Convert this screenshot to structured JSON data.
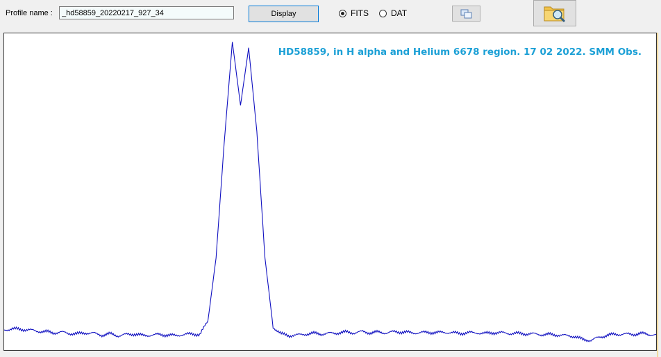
{
  "toolbar": {
    "profile_label": "Profile name :",
    "profile_value": "_hd58859_20220217_927_34",
    "display_label": "Display",
    "radio_fits_label": "FITS",
    "radio_dat_label": "DAT",
    "selected_format": "FITS"
  },
  "icons": {
    "copy": "copy-icon",
    "open": "folder-search-icon"
  },
  "plot": {
    "title": "HD58859, in H alpha and Helium 6678 region.  17 02 2022. SMM Obs.",
    "title_color": "#1ca0d6",
    "line_color": "#1010c0"
  },
  "chart_data": {
    "type": "line",
    "title": "HD58859, in H alpha and Helium 6678 region.  17 02 2022. SMM Obs.",
    "xlabel": "",
    "ylabel": "",
    "grid": false,
    "x": [
      0,
      5,
      10,
      15,
      20,
      25,
      30,
      35,
      40,
      45,
      50,
      55,
      60,
      65,
      70,
      75,
      80,
      85,
      90,
      95,
      100,
      105,
      110,
      115,
      120,
      125,
      130,
      135,
      140,
      145,
      150,
      155,
      160,
      165,
      170,
      175,
      180,
      185,
      190,
      195,
      200,
      205,
      210,
      215,
      220,
      225,
      230,
      235,
      240,
      245,
      250,
      255,
      260,
      265,
      270,
      275,
      280,
      285,
      290,
      295,
      300,
      305,
      310,
      315,
      320,
      325,
      330,
      335,
      340,
      345,
      350,
      355,
      360,
      365,
      370,
      375,
      380,
      385,
      390,
      395,
      400
    ],
    "y": [
      1.05,
      1.07,
      1.06,
      1.05,
      1.03,
      1.02,
      1.0,
      1.01,
      0.99,
      0.98,
      1.0,
      0.99,
      0.96,
      0.98,
      0.95,
      0.97,
      0.98,
      0.95,
      0.96,
      0.97,
      0.96,
      0.95,
      0.97,
      0.98,
      0.97,
      1.2,
      2.3,
      4.3,
      6.05,
      4.95,
      5.95,
      4.5,
      2.3,
      1.1,
      0.98,
      0.95,
      0.96,
      0.98,
      0.99,
      0.98,
      0.99,
      1.0,
      1.01,
      1.0,
      1.02,
      1.0,
      1.01,
      1.0,
      1.02,
      1.01,
      1.0,
      1.0,
      1.01,
      1.0,
      1.01,
      1.0,
      0.99,
      1.0,
      1.0,
      0.99,
      1.0,
      1.0,
      0.99,
      0.99,
      0.98,
      0.98,
      0.97,
      0.97,
      0.96,
      0.95,
      0.94,
      0.88,
      0.87,
      0.92,
      0.96,
      0.97,
      0.98,
      0.97,
      0.99,
      0.97,
      0.97
    ],
    "xlim": [
      0,
      400
    ],
    "ylim": [
      0.7,
      6.2
    ]
  }
}
